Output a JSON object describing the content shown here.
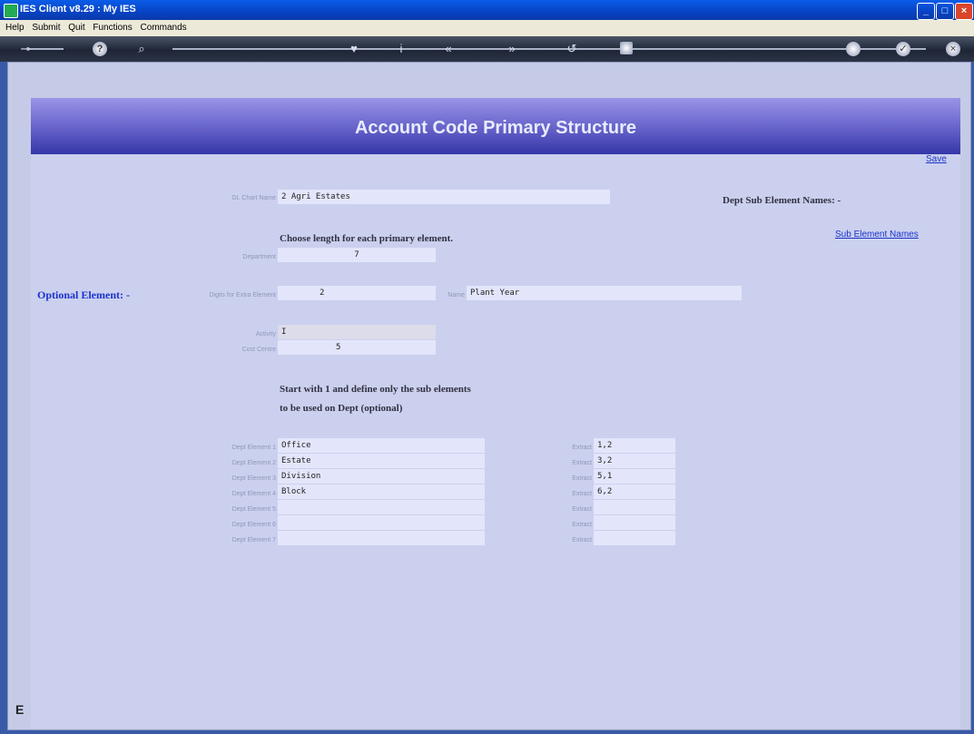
{
  "window": {
    "title": "IES Client v8.29 : My IES"
  },
  "menu": {
    "items": [
      "Help",
      "Submit",
      "Quit",
      "Functions",
      "Commands"
    ]
  },
  "toolbar": {
    "help": "?",
    "search": "⌕",
    "info": "i",
    "back": "«",
    "forward": "»",
    "refresh": "↺",
    "confirm": "✓",
    "close": "×"
  },
  "page": {
    "title": "Account Code Primary Structure"
  },
  "actions": {
    "save": "Save",
    "sub_element_names": "Sub Element Names"
  },
  "form": {
    "chart_name_label": "GL Chart Name",
    "chart_name_value": "2 Agri Estates",
    "dept_sub_element_names_label": "Dept Sub Element Names: -",
    "choose_length_heading": "Choose length for each primary element.",
    "department_label": "Department",
    "department_value": "7",
    "optional_element_label": "Optional Element: -",
    "optional_digits_label": "Digits for Extra Element",
    "optional_digits_value": "2",
    "optional_name_label": "Name",
    "optional_name_value": "Plant Year",
    "activity_label": "Activity",
    "activity_value": "I",
    "cost_centre_label": "Cost Centre",
    "cost_centre_value": "5",
    "sub_heading_line1": "Start with 1 and define only the sub elements",
    "sub_heading_line2": "to be used on Dept (optional)"
  },
  "dept_elements": [
    {
      "label": "Dept Element 1",
      "value": "Office",
      "extract_label": "Extract",
      "extract": "1,2"
    },
    {
      "label": "Dept Element 2",
      "value": "Estate",
      "extract_label": "Extract",
      "extract": "3,2"
    },
    {
      "label": "Dept Element 3",
      "value": "Division",
      "extract_label": "Extract",
      "extract": "5,1"
    },
    {
      "label": "Dept Element 4",
      "value": "Block",
      "extract_label": "Extract",
      "extract": "6,2"
    },
    {
      "label": "Dept Element 5",
      "value": "",
      "extract_label": "Extract",
      "extract": ""
    },
    {
      "label": "Dept Element 6",
      "value": "",
      "extract_label": "Extract",
      "extract": ""
    },
    {
      "label": "Dept Element 7",
      "value": "",
      "extract_label": "Extract",
      "extract": ""
    }
  ],
  "side": {
    "bottom_letter": "E"
  }
}
